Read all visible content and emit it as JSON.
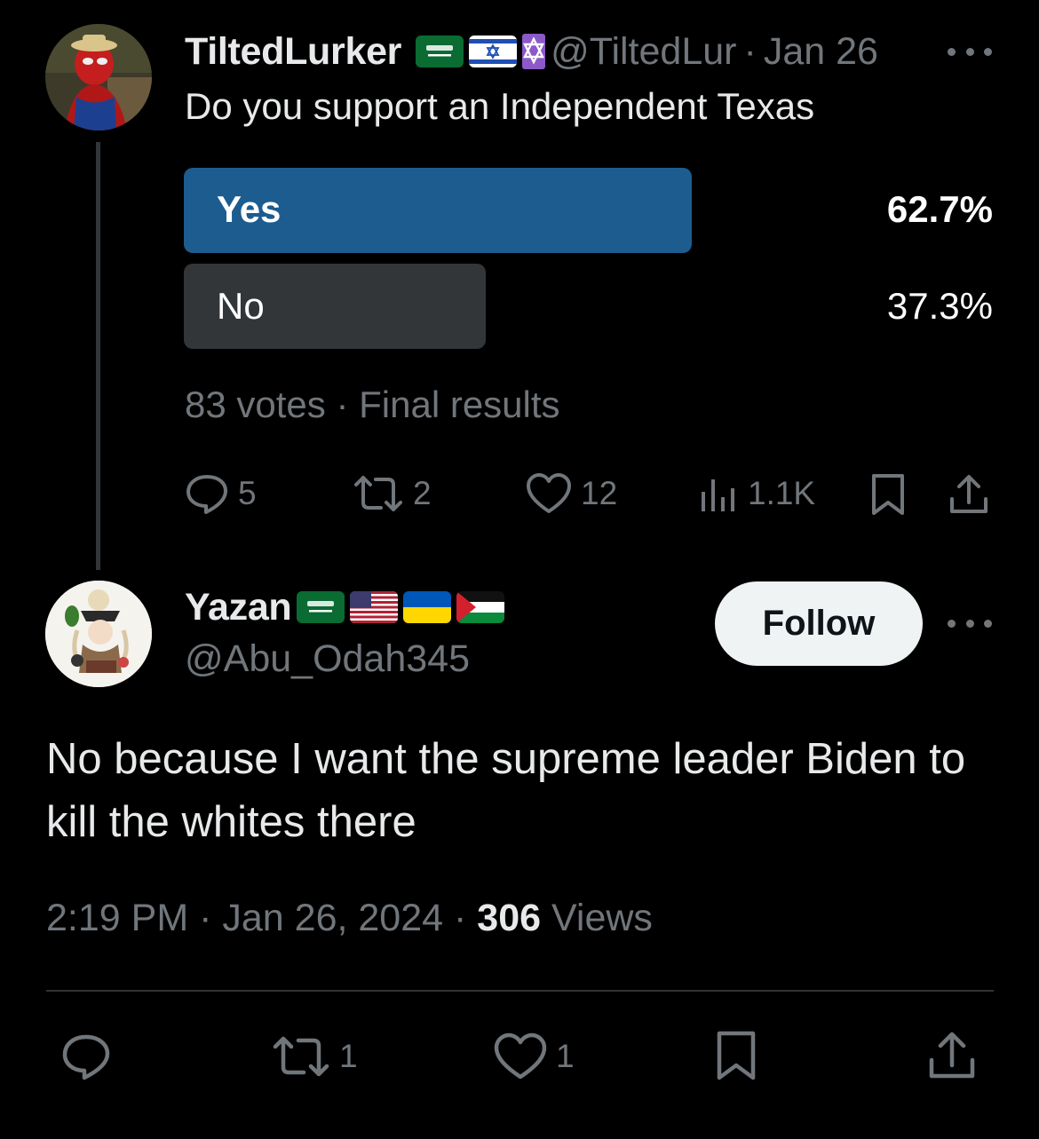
{
  "parent_tweet": {
    "display_name": "TiltedLurker",
    "flags": [
      "saudi-arabia-flag",
      "israel-flag",
      "star-of-david-icon"
    ],
    "handle": "@TiltedLur",
    "separator": "·",
    "date": "Jan 26",
    "text": "Do you support an Independent Texas",
    "poll": {
      "options": [
        {
          "label": "Yes",
          "percent": "62.7%",
          "fraction": 0.627,
          "winner": true
        },
        {
          "label": "No",
          "percent": "37.3%",
          "fraction": 0.373,
          "winner": false
        }
      ],
      "votes": "83 votes",
      "separator": "·",
      "status": "Final results"
    },
    "actions": {
      "replies": "5",
      "reposts": "2",
      "likes": "12",
      "views": "1.1K"
    }
  },
  "reply_tweet": {
    "display_name": "Yazan",
    "flags": [
      "saudi-arabia-flag",
      "usa-flag",
      "ukraine-flag",
      "palestine-flag"
    ],
    "handle": "@Abu_Odah345",
    "follow_label": "Follow",
    "text": "No because I want the supreme leader Biden to kill the whites there",
    "time": "2:19 PM",
    "sep1": "·",
    "date": "Jan 26, 2024",
    "sep2": "·",
    "views_count": "306",
    "views_label": "Views",
    "actions": {
      "reposts": "1",
      "likes": "1"
    }
  },
  "colors": {
    "background": "#000000",
    "poll_winner": "#1d5c8f",
    "poll_loser": "#333639",
    "muted_text": "#71767b",
    "primary_text": "#e7e9ea",
    "follow_button": "#eff3f4"
  }
}
